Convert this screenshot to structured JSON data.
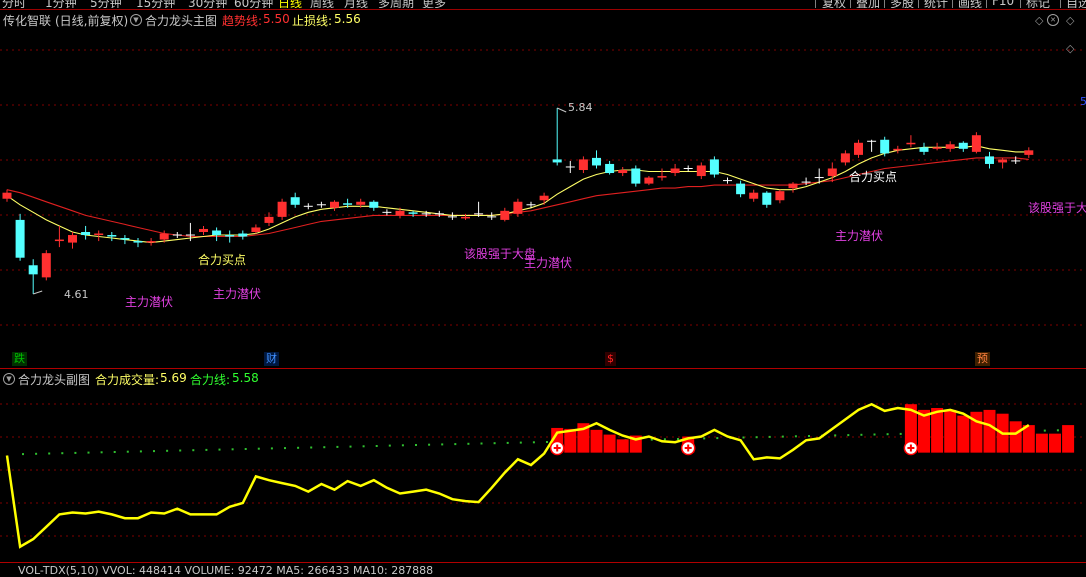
{
  "toolbar": {
    "periods": [
      "分时",
      "1分钟",
      "5分钟",
      "15分钟",
      "30分钟",
      "60分钟",
      "日线",
      "周线",
      "月线",
      "多周期",
      "更多"
    ],
    "active_period": "日线",
    "right_buttons": [
      "复权",
      "叠加",
      "多股",
      "统计",
      "画线",
      "F10",
      "标记",
      "自选"
    ]
  },
  "main_panel": {
    "stock_name": "传化智联",
    "period_info": "(日线,前复权)",
    "indicator_name": "合力龙头主图",
    "trend_line_label": "趋势线:",
    "trend_line_value": "5.50",
    "stop_line_label": "止损线:",
    "stop_line_value": "5.56",
    "high_mark": "5.84",
    "low_mark": "4.61",
    "annotations": [
      {
        "text": "合力买点",
        "color": "#ffff66"
      },
      {
        "text": "主力潜伏",
        "color": "#e040e0"
      },
      {
        "text": "主力潜伏",
        "color": "#e040e0"
      },
      {
        "text": "该股强于大盘",
        "color": "#e040e0"
      },
      {
        "text": "主力潜伏",
        "color": "#e040e0"
      },
      {
        "text": "合力买点",
        "color": "#ffffff"
      },
      {
        "text": "主力潜伏",
        "color": "#e040e0"
      },
      {
        "text": "该股强于大盘",
        "color": "#e040e0"
      }
    ],
    "markers": [
      {
        "text": "跌",
        "color": "#00c000"
      },
      {
        "text": "财",
        "color": "#4090ff"
      },
      {
        "text": "$",
        "color": "#ff2020"
      },
      {
        "text": "预",
        "color": "#ff8040"
      }
    ]
  },
  "sub_panel": {
    "indicator_name": "合力龙头副图",
    "volume_label": "合力成交量:",
    "volume_value": "5.69",
    "line_label": "合力线:",
    "line_value": "5.58"
  },
  "bottom_bar": {
    "text": "VOL-TDX(5,10)  VVOL: 448414  VOLUME: 92472  MA5: 266433  MA10: 287888"
  },
  "colors": {
    "up": "#ff3030",
    "down": "#54ffff",
    "ma_yellow": "#ffff66",
    "ma_red": "#e02020",
    "grid": "#800000"
  },
  "chart_data": [
    {
      "type": "candlestick",
      "title": "合力龙头主图",
      "candles": [
        [
          5.24,
          5.28,
          5.22,
          5.3
        ],
        [
          5.1,
          4.85,
          4.83,
          5.14
        ],
        [
          4.8,
          4.74,
          4.61,
          4.84
        ],
        [
          4.72,
          4.88,
          4.7,
          4.9
        ],
        [
          4.96,
          4.97,
          4.92,
          5.06
        ],
        [
          4.95,
          5.0,
          4.91,
          5.02
        ],
        [
          5.02,
          5.0,
          4.97,
          5.06
        ],
        [
          5.0,
          5.01,
          4.96,
          5.03
        ],
        [
          5.0,
          4.99,
          4.96,
          5.02
        ],
        [
          4.98,
          4.97,
          4.94,
          5.0
        ],
        [
          4.96,
          4.95,
          4.92,
          4.98
        ],
        [
          4.95,
          4.96,
          4.93,
          4.98
        ],
        [
          4.97,
          5.01,
          4.95,
          5.03
        ],
        [
          5.0,
          5.0,
          4.98,
          5.02
        ],
        [
          5.0,
          5.0,
          4.96,
          5.08
        ],
        [
          5.02,
          5.04,
          5.0,
          5.06
        ],
        [
          5.03,
          5.0,
          4.96,
          5.05
        ],
        [
          5.0,
          4.99,
          4.95,
          5.03
        ],
        [
          5.01,
          4.99,
          4.97,
          5.03
        ],
        [
          5.02,
          5.05,
          5.01,
          5.07
        ],
        [
          5.08,
          5.12,
          5.06,
          5.15
        ],
        [
          5.12,
          5.22,
          5.1,
          5.24
        ],
        [
          5.25,
          5.2,
          5.18,
          5.28
        ],
        [
          5.19,
          5.19,
          5.17,
          5.21
        ],
        [
          5.2,
          5.2,
          5.18,
          5.22
        ],
        [
          5.18,
          5.22,
          5.16,
          5.23
        ],
        [
          5.21,
          5.2,
          5.18,
          5.24
        ],
        [
          5.2,
          5.22,
          5.18,
          5.24
        ],
        [
          5.22,
          5.18,
          5.16,
          5.23
        ],
        [
          5.15,
          5.15,
          5.13,
          5.17
        ],
        [
          5.13,
          5.16,
          5.11,
          5.18
        ],
        [
          5.15,
          5.14,
          5.12,
          5.16
        ],
        [
          5.14,
          5.14,
          5.12,
          5.16
        ],
        [
          5.14,
          5.14,
          5.12,
          5.16
        ],
        [
          5.12,
          5.12,
          5.1,
          5.15
        ],
        [
          5.11,
          5.12,
          5.1,
          5.14
        ],
        [
          5.14,
          5.14,
          5.12,
          5.22
        ],
        [
          5.12,
          5.12,
          5.1,
          5.15
        ],
        [
          5.1,
          5.16,
          5.09,
          5.18
        ],
        [
          5.14,
          5.22,
          5.12,
          5.24
        ],
        [
          5.2,
          5.2,
          5.18,
          5.22
        ],
        [
          5.23,
          5.26,
          5.2,
          5.28
        ],
        [
          5.5,
          5.48,
          5.46,
          5.84
        ],
        [
          5.45,
          5.45,
          5.41,
          5.49
        ],
        [
          5.43,
          5.5,
          5.41,
          5.52
        ],
        [
          5.51,
          5.46,
          5.44,
          5.56
        ],
        [
          5.47,
          5.41,
          5.4,
          5.49
        ],
        [
          5.41,
          5.43,
          5.39,
          5.45
        ],
        [
          5.44,
          5.34,
          5.32,
          5.46
        ],
        [
          5.34,
          5.38,
          5.33,
          5.39
        ],
        [
          5.38,
          5.39,
          5.36,
          5.44
        ],
        [
          5.41,
          5.44,
          5.39,
          5.47
        ],
        [
          5.44,
          5.44,
          5.42,
          5.46
        ],
        [
          5.39,
          5.46,
          5.37,
          5.48
        ],
        [
          5.5,
          5.4,
          5.38,
          5.52
        ],
        [
          5.36,
          5.36,
          5.34,
          5.38
        ],
        [
          5.34,
          5.27,
          5.25,
          5.36
        ],
        [
          5.24,
          5.28,
          5.22,
          5.3
        ],
        [
          5.28,
          5.2,
          5.18,
          5.29
        ],
        [
          5.23,
          5.29,
          5.21,
          5.3
        ],
        [
          5.31,
          5.34,
          5.28,
          5.35
        ],
        [
          5.35,
          5.35,
          5.33,
          5.38
        ],
        [
          5.38,
          5.38,
          5.34,
          5.44
        ],
        [
          5.39,
          5.44,
          5.35,
          5.48
        ],
        [
          5.48,
          5.54,
          5.46,
          5.56
        ],
        [
          5.53,
          5.61,
          5.51,
          5.63
        ],
        [
          5.62,
          5.62,
          5.55,
          5.63
        ],
        [
          5.63,
          5.54,
          5.52,
          5.65
        ],
        [
          5.56,
          5.57,
          5.54,
          5.59
        ],
        [
          5.6,
          5.61,
          5.58,
          5.66
        ],
        [
          5.58,
          5.55,
          5.53,
          5.61
        ],
        [
          5.57,
          5.58,
          5.56,
          5.61
        ],
        [
          5.57,
          5.6,
          5.55,
          5.62
        ],
        [
          5.61,
          5.57,
          5.55,
          5.62
        ],
        [
          5.55,
          5.66,
          5.54,
          5.68
        ],
        [
          5.52,
          5.47,
          5.44,
          5.55
        ],
        [
          5.48,
          5.5,
          5.44,
          5.51
        ],
        [
          5.49,
          5.49,
          5.47,
          5.52
        ],
        [
          5.53,
          5.56,
          5.51,
          5.58
        ]
      ],
      "ma_yellow": [
        5.26,
        5.2,
        5.15,
        5.1,
        5.06,
        5.02,
        5.0,
        4.99,
        4.98,
        4.97,
        4.96,
        4.95,
        4.96,
        4.97,
        4.98,
        4.99,
        5.0,
        5.0,
        5.0,
        5.01,
        5.04,
        5.08,
        5.12,
        5.15,
        5.17,
        5.18,
        5.19,
        5.19,
        5.19,
        5.18,
        5.17,
        5.16,
        5.15,
        5.14,
        5.13,
        5.13,
        5.13,
        5.13,
        5.14,
        5.16,
        5.18,
        5.21,
        5.27,
        5.32,
        5.37,
        5.4,
        5.42,
        5.43,
        5.43,
        5.42,
        5.42,
        5.42,
        5.42,
        5.42,
        5.42,
        5.4,
        5.37,
        5.34,
        5.31,
        5.3,
        5.3,
        5.32,
        5.35,
        5.38,
        5.42,
        5.47,
        5.51,
        5.54,
        5.56,
        5.57,
        5.58,
        5.58,
        5.58,
        5.58,
        5.59,
        5.57,
        5.56,
        5.55,
        5.55
      ],
      "ma_red": [
        5.3,
        5.28,
        5.25,
        5.22,
        5.19,
        5.16,
        5.13,
        5.11,
        5.09,
        5.07,
        5.05,
        5.03,
        5.01,
        5.0,
        4.99,
        4.99,
        4.99,
        4.99,
        4.99,
        5.0,
        5.01,
        5.03,
        5.05,
        5.07,
        5.09,
        5.1,
        5.11,
        5.12,
        5.13,
        5.13,
        5.13,
        5.13,
        5.13,
        5.13,
        5.13,
        5.13,
        5.13,
        5.13,
        5.14,
        5.15,
        5.16,
        5.18,
        5.2,
        5.22,
        5.24,
        5.26,
        5.27,
        5.28,
        5.29,
        5.3,
        5.31,
        5.31,
        5.32,
        5.32,
        5.33,
        5.33,
        5.33,
        5.33,
        5.33,
        5.33,
        5.33,
        5.34,
        5.35,
        5.36,
        5.38,
        5.4,
        5.42,
        5.44,
        5.45,
        5.46,
        5.47,
        5.48,
        5.49,
        5.5,
        5.51,
        5.51,
        5.51,
        5.51,
        5.5
      ]
    },
    {
      "type": "line",
      "title": "合力龙头副图",
      "line": [
        5.0,
        -4.6,
        -3.8,
        -2.5,
        -1.2,
        -1.0,
        -1.1,
        -0.9,
        -1.2,
        -1.6,
        -1.6,
        -1.0,
        -1.1,
        -0.6,
        -1.2,
        -1.2,
        -1.2,
        -0.4,
        0.0,
        2.8,
        2.4,
        2.1,
        1.8,
        1.2,
        2.0,
        1.4,
        2.3,
        1.8,
        2.4,
        1.6,
        1.0,
        1.2,
        1.4,
        1.0,
        0.4,
        0.2,
        0.1,
        1.6,
        3.2,
        4.6,
        4.0,
        5.2,
        7.4,
        7.6,
        7.8,
        8.4,
        7.7,
        7.1,
        6.7,
        7.0,
        6.5,
        6.4,
        6.8,
        7.0,
        7.7,
        7.0,
        6.6,
        4.6,
        4.8,
        4.7,
        5.6,
        6.6,
        6.8,
        7.8,
        8.8,
        9.8,
        10.4,
        9.7,
        10.0,
        9.8,
        9.2,
        9.6,
        9.8,
        9.4,
        8.6,
        8.2,
        7.3,
        7.3,
        8.2
      ],
      "bars": [
        [
          42,
          7.9
        ],
        [
          43,
          7.8
        ],
        [
          44,
          8.4
        ],
        [
          45,
          7.7
        ],
        [
          46,
          7.2
        ],
        [
          47,
          6.7
        ],
        [
          48,
          7.1
        ],
        [
          52,
          7.0
        ],
        [
          69,
          10.4
        ],
        [
          70,
          9.8
        ],
        [
          71,
          10.0
        ],
        [
          72,
          9.8
        ],
        [
          73,
          9.2
        ],
        [
          74,
          9.6
        ],
        [
          75,
          9.8
        ],
        [
          76,
          9.4
        ],
        [
          77,
          8.6
        ],
        [
          78,
          8.2
        ],
        [
          79,
          7.3
        ],
        [
          80,
          7.3
        ],
        [
          81,
          8.2
        ]
      ],
      "signals": [
        42,
        52,
        69
      ],
      "ylim": [
        -6,
        12
      ]
    }
  ]
}
